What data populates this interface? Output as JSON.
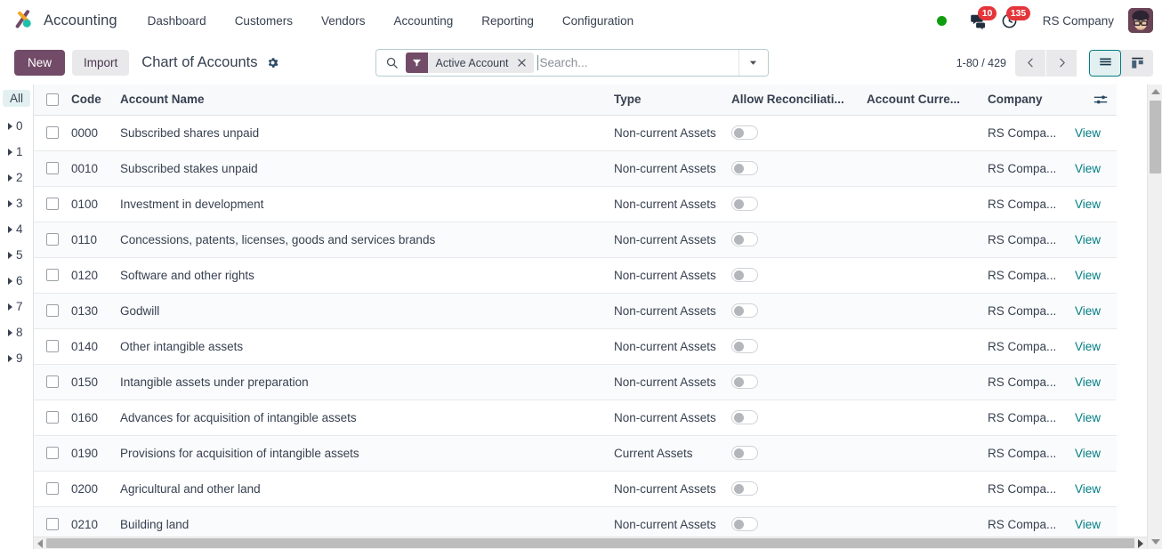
{
  "navbar": {
    "brand": "Accounting",
    "menu": [
      {
        "label": "Dashboard"
      },
      {
        "label": "Customers"
      },
      {
        "label": "Vendors"
      },
      {
        "label": "Accounting"
      },
      {
        "label": "Reporting"
      },
      {
        "label": "Configuration"
      }
    ],
    "messages_count": "10",
    "activities_count": "135",
    "company": "RS Company",
    "status_color": "#0f9d0f",
    "badge_color": "#e4363a"
  },
  "control_panel": {
    "new_label": "New",
    "import_label": "Import",
    "title": "Chart of Accounts",
    "pager": "1-80 / 429",
    "accent_purple": "#714b67",
    "accent_teal": "#017e84"
  },
  "search": {
    "placeholder": "Search...",
    "value": "",
    "facet_label": "Active Account"
  },
  "side_panel": {
    "all_label": "All",
    "groups": [
      "0",
      "1",
      "2",
      "3",
      "4",
      "5",
      "6",
      "7",
      "8",
      "9"
    ]
  },
  "list": {
    "columns": [
      {
        "key": "code",
        "label": "Code"
      },
      {
        "key": "name",
        "label": "Account Name"
      },
      {
        "key": "type",
        "label": "Type"
      },
      {
        "key": "reconcile",
        "label": "Allow Reconciliati..."
      },
      {
        "key": "currency",
        "label": "Account Curre..."
      },
      {
        "key": "company",
        "label": "Company"
      }
    ],
    "view_link_label": "View",
    "rows": [
      {
        "code": "0000",
        "name": "Subscribed shares unpaid",
        "type": "Non-current Assets",
        "reconcile": false,
        "currency": "",
        "company": "RS Compa..."
      },
      {
        "code": "0010",
        "name": "Subscribed stakes unpaid",
        "type": "Non-current Assets",
        "reconcile": false,
        "currency": "",
        "company": "RS Compa..."
      },
      {
        "code": "0100",
        "name": "Investment in development",
        "type": "Non-current Assets",
        "reconcile": false,
        "currency": "",
        "company": "RS Compa..."
      },
      {
        "code": "0110",
        "name": "Concessions, patents, licenses, goods and services brands",
        "type": "Non-current Assets",
        "reconcile": false,
        "currency": "",
        "company": "RS Compa..."
      },
      {
        "code": "0120",
        "name": "Software and other rights",
        "type": "Non-current Assets",
        "reconcile": false,
        "currency": "",
        "company": "RS Compa..."
      },
      {
        "code": "0130",
        "name": "Godwill",
        "type": "Non-current Assets",
        "reconcile": false,
        "currency": "",
        "company": "RS Compa..."
      },
      {
        "code": "0140",
        "name": "Other intangible assets",
        "type": "Non-current Assets",
        "reconcile": false,
        "currency": "",
        "company": "RS Compa..."
      },
      {
        "code": "0150",
        "name": "Intangible assets under preparation",
        "type": "Non-current Assets",
        "reconcile": false,
        "currency": "",
        "company": "RS Compa..."
      },
      {
        "code": "0160",
        "name": "Advances for acquisition of intangible assets",
        "type": "Non-current Assets",
        "reconcile": false,
        "currency": "",
        "company": "RS Compa..."
      },
      {
        "code": "0190",
        "name": "Provisions for acquisition of intangible assets",
        "type": "Current Assets",
        "reconcile": false,
        "currency": "",
        "company": "RS Compa..."
      },
      {
        "code": "0200",
        "name": "Agricultural and other land",
        "type": "Non-current Assets",
        "reconcile": false,
        "currency": "",
        "company": "RS Compa..."
      },
      {
        "code": "0210",
        "name": "Building land",
        "type": "Non-current Assets",
        "reconcile": false,
        "currency": "",
        "company": "RS Compa..."
      }
    ]
  }
}
